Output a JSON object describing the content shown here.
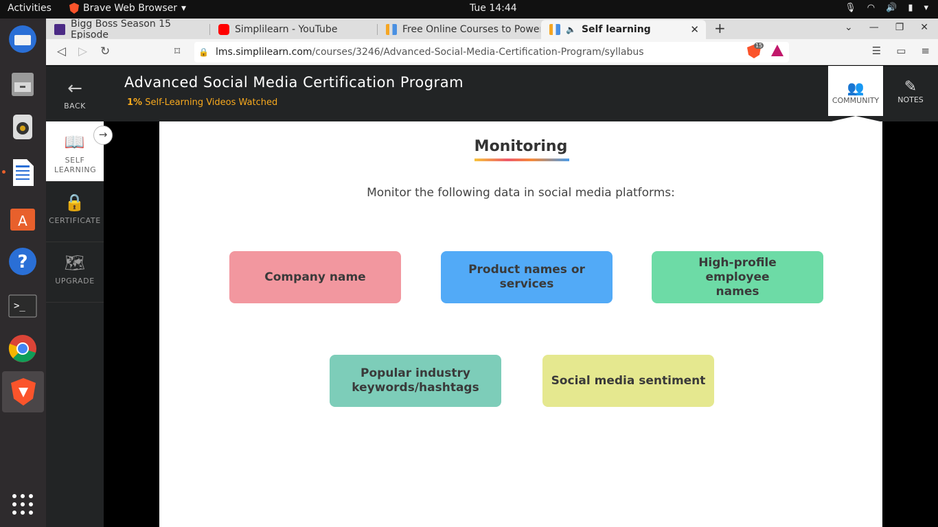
{
  "system": {
    "activities": "Activities",
    "app_name": "Brave Web Browser",
    "clock": "Tue 14:44"
  },
  "tabs": [
    {
      "title": "Bigg Boss Season 15 Episode",
      "favicon_color": "#4b2a85"
    },
    {
      "title": "Simplilearn - YouTube",
      "favicon_color": "#ff0000"
    },
    {
      "title": "Free Online Courses to Power",
      "favicon_color": "#f5a623"
    },
    {
      "title": "Self learning",
      "favicon_color": "#f5a623",
      "active": true
    }
  ],
  "url": {
    "host": "lms.simplilearn.com",
    "path": "/courses/3246/Advanced-Social-Media-Certification-Program/syllabus"
  },
  "shield_count": "15",
  "lms": {
    "back_label": "BACK",
    "course_title": "Advanced Social Media Certification Program",
    "progress_pct": "1%",
    "progress_text": " Self-Learning Videos Watched",
    "community_label": "COMMUNITY",
    "notes_label": "NOTES",
    "sidebar": [
      {
        "label": "SELF LEARNING",
        "active": true
      },
      {
        "label": "CERTIFICATE"
      },
      {
        "label": "UPGRADE"
      }
    ]
  },
  "slide": {
    "title": "Monitoring",
    "subtitle": "Monitor the following data in social media platforms:",
    "boxes": [
      {
        "label": "Company name",
        "color": "#f2979f"
      },
      {
        "label": "Product names or services",
        "color": "#52aaf7"
      },
      {
        "label": "High-profile employee names",
        "color": "#6ddba6"
      },
      {
        "label": "Popular industry keywords/hashtags",
        "color": "#7dcdb9"
      },
      {
        "label": "Social media sentiment",
        "color": "#e5e88f"
      }
    ]
  }
}
